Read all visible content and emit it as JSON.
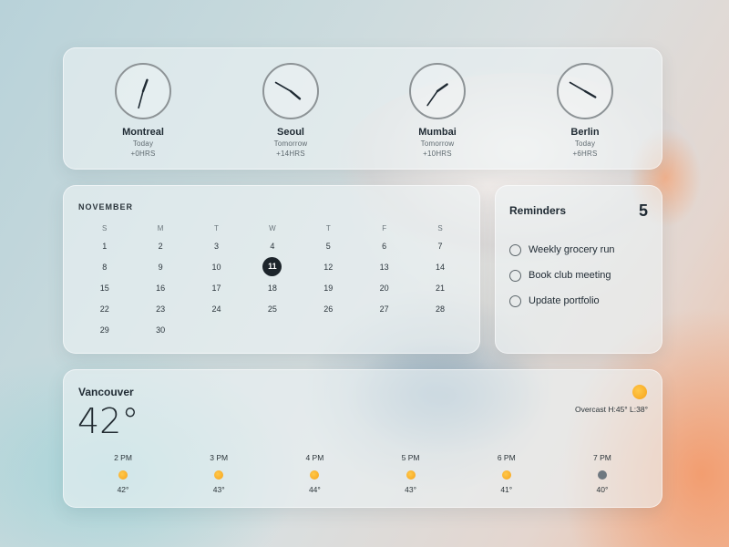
{
  "clocks": [
    {
      "city": "Montreal",
      "day": "Today",
      "offset": "+0HRS",
      "hour_deg": 20,
      "minute_deg": 195
    },
    {
      "city": "Seoul",
      "day": "Tomorrow",
      "offset": "+14HRS",
      "hour_deg": 130,
      "minute_deg": 300
    },
    {
      "city": "Mumbai",
      "day": "Tomorrow",
      "offset": "+10HRS",
      "hour_deg": 55,
      "minute_deg": 215
    },
    {
      "city": "Berlin",
      "day": "Today",
      "offset": "+6HRS",
      "hour_deg": 120,
      "minute_deg": 300
    }
  ],
  "calendar": {
    "month": "NOVEMBER",
    "weekdays": [
      "S",
      "M",
      "T",
      "W",
      "T",
      "F",
      "S"
    ],
    "selected_day": "11",
    "weeks": [
      [
        "1",
        "2",
        "3",
        "4",
        "5",
        "6",
        "7"
      ],
      [
        "8",
        "9",
        "10",
        "11",
        "12",
        "13",
        "14"
      ],
      [
        "15",
        "16",
        "17",
        "18",
        "19",
        "20",
        "21"
      ],
      [
        "22",
        "23",
        "24",
        "25",
        "26",
        "27",
        "28"
      ],
      [
        "29",
        "30",
        "",
        "",
        "",
        "",
        ""
      ]
    ]
  },
  "reminders": {
    "title": "Reminders",
    "count": "5",
    "items": [
      "Weekly grocery run",
      "Book club meeting",
      "Update portfolio"
    ]
  },
  "weather": {
    "city": "Vancouver",
    "temperature": "42°",
    "condition": "Overcast H:45° L:38°",
    "icon": "sun-icon",
    "hourly": [
      {
        "time": "2 PM",
        "icon": "sun",
        "temp": "42°"
      },
      {
        "time": "3 PM",
        "icon": "sun",
        "temp": "43°"
      },
      {
        "time": "4 PM",
        "icon": "sun",
        "temp": "44°"
      },
      {
        "time": "5 PM",
        "icon": "sun",
        "temp": "43°"
      },
      {
        "time": "6 PM",
        "icon": "sun",
        "temp": "41°"
      },
      {
        "time": "7 PM",
        "icon": "cloud",
        "temp": "40°"
      }
    ]
  },
  "colors": {
    "sun": "#f6a21a",
    "today_highlight": "#1d252b",
    "cloud": "#6e7880"
  }
}
